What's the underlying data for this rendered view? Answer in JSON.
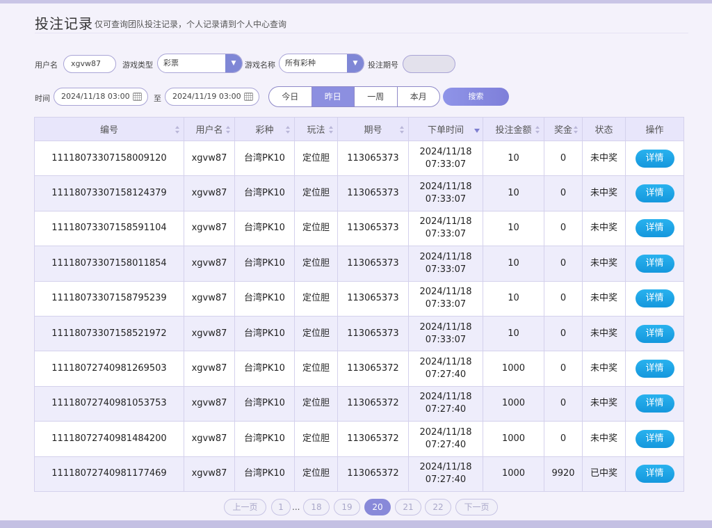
{
  "header": {
    "title": "投注记录",
    "subtitle": "仅可查询团队投注记录，个人记录请到个人中心查询"
  },
  "filters": {
    "username_label": "用户名",
    "username_value": "xgvw87",
    "game_type_label": "游戏类型",
    "game_type_value": "彩票",
    "game_name_label": "游戏名称",
    "game_name_value": "所有彩种",
    "issue_label": "投注期号",
    "issue_value": "",
    "time_label": "时间",
    "start_time": "2024/11/18 03:00",
    "to_label": "至",
    "end_time": "2024/11/19 03:00",
    "quick_ranges": [
      "今日",
      "昨日",
      "一周",
      "本月"
    ],
    "active_range": "昨日",
    "search_label": "搜索"
  },
  "table": {
    "columns": [
      "编号",
      "用户名",
      "彩种",
      "玩法",
      "期号",
      "下单时间",
      "投注金额",
      "奖金",
      "状态",
      "操作"
    ],
    "detail_label": "详情",
    "rows": [
      {
        "id": "11118073307158009120",
        "user": "xgvw87",
        "lottery": "台湾PK10",
        "play": "定位胆",
        "issue": "113065373",
        "date": "2024/11/18",
        "time": "07:33:07",
        "amount": "10",
        "bonus": "0",
        "status": "未中奖",
        "won": false
      },
      {
        "id": "11118073307158124379",
        "user": "xgvw87",
        "lottery": "台湾PK10",
        "play": "定位胆",
        "issue": "113065373",
        "date": "2024/11/18",
        "time": "07:33:07",
        "amount": "10",
        "bonus": "0",
        "status": "未中奖",
        "won": false
      },
      {
        "id": "11118073307158591104",
        "user": "xgvw87",
        "lottery": "台湾PK10",
        "play": "定位胆",
        "issue": "113065373",
        "date": "2024/11/18",
        "time": "07:33:07",
        "amount": "10",
        "bonus": "0",
        "status": "未中奖",
        "won": false
      },
      {
        "id": "11118073307158011854",
        "user": "xgvw87",
        "lottery": "台湾PK10",
        "play": "定位胆",
        "issue": "113065373",
        "date": "2024/11/18",
        "time": "07:33:07",
        "amount": "10",
        "bonus": "0",
        "status": "未中奖",
        "won": false
      },
      {
        "id": "11118073307158795239",
        "user": "xgvw87",
        "lottery": "台湾PK10",
        "play": "定位胆",
        "issue": "113065373",
        "date": "2024/11/18",
        "time": "07:33:07",
        "amount": "10",
        "bonus": "0",
        "status": "未中奖",
        "won": false
      },
      {
        "id": "11118073307158521972",
        "user": "xgvw87",
        "lottery": "台湾PK10",
        "play": "定位胆",
        "issue": "113065373",
        "date": "2024/11/18",
        "time": "07:33:07",
        "amount": "10",
        "bonus": "0",
        "status": "未中奖",
        "won": false
      },
      {
        "id": "11118072740981269503",
        "user": "xgvw87",
        "lottery": "台湾PK10",
        "play": "定位胆",
        "issue": "113065372",
        "date": "2024/11/18",
        "time": "07:27:40",
        "amount": "1000",
        "bonus": "0",
        "status": "未中奖",
        "won": false
      },
      {
        "id": "11118072740981053753",
        "user": "xgvw87",
        "lottery": "台湾PK10",
        "play": "定位胆",
        "issue": "113065372",
        "date": "2024/11/18",
        "time": "07:27:40",
        "amount": "1000",
        "bonus": "0",
        "status": "未中奖",
        "won": false
      },
      {
        "id": "11118072740981484200",
        "user": "xgvw87",
        "lottery": "台湾PK10",
        "play": "定位胆",
        "issue": "113065372",
        "date": "2024/11/18",
        "time": "07:27:40",
        "amount": "1000",
        "bonus": "0",
        "status": "未中奖",
        "won": false
      },
      {
        "id": "11118072740981177469",
        "user": "xgvw87",
        "lottery": "台湾PK10",
        "play": "定位胆",
        "issue": "113065372",
        "date": "2024/11/18",
        "time": "07:27:40",
        "amount": "1000",
        "bonus": "9920",
        "status": "已中奖",
        "won": true
      }
    ]
  },
  "pagination": {
    "prev_label": "上一页",
    "next_label": "下一页",
    "first_page": "1",
    "ellipsis": "...",
    "pages": [
      "18",
      "19",
      "20",
      "21",
      "22"
    ],
    "current_page": "20"
  }
}
